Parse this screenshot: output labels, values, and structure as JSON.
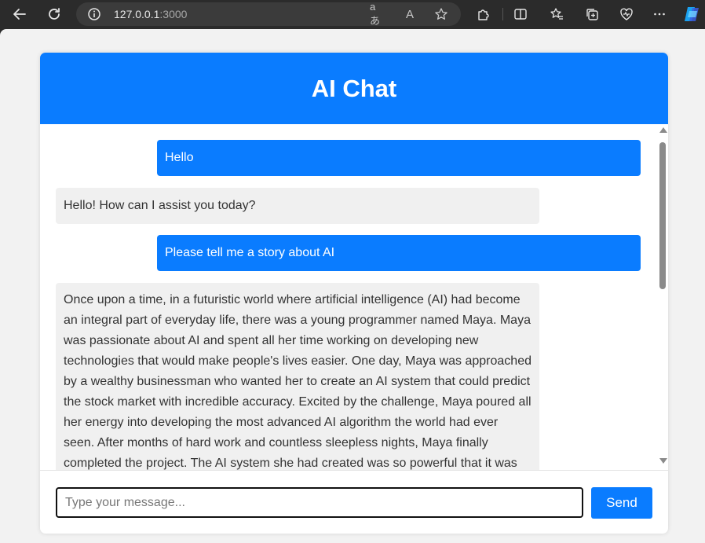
{
  "browser": {
    "url_host": "127.0.0.1",
    "url_port": ":3000",
    "read_aloud_label": "aあ",
    "reader_label": "A"
  },
  "chat": {
    "title": "AI Chat",
    "messages": [
      {
        "role": "user",
        "text": "Hello"
      },
      {
        "role": "ai",
        "text": "Hello! How can I assist you today?"
      },
      {
        "role": "user",
        "text": "Please tell me a story about AI"
      },
      {
        "role": "ai",
        "text": "Once upon a time, in a futuristic world where artificial intelligence (AI) had become an integral part of everyday life, there was a young programmer named Maya. Maya was passionate about AI and spent all her time working on developing new technologies that would make people's lives easier. One day, Maya was approached by a wealthy businessman who wanted her to create an AI system that could predict the stock market with incredible accuracy. Excited by the challenge, Maya poured all her energy into developing the most advanced AI algorithm the world had ever seen. After months of hard work and countless sleepless nights, Maya finally completed the project. The AI system she had created was so powerful that it was"
      }
    ],
    "input_placeholder": "Type your message...",
    "send_label": "Send"
  },
  "colors": {
    "accent": "#0a7cff",
    "ai_bubble": "#f0f0f0",
    "chrome_bg": "#2b2b2b",
    "page_bg": "#f2f2f2"
  }
}
